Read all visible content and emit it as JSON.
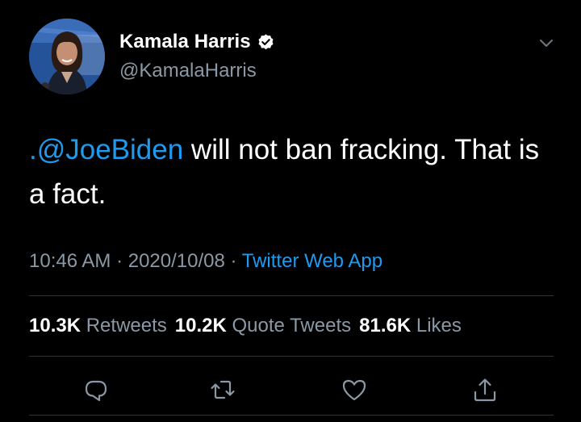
{
  "user": {
    "display_name": "Kamala Harris",
    "handle": "@KamalaHarris",
    "verified": true,
    "avatar_icon": "profile-photo"
  },
  "tweet": {
    "mention": ".@JoeBiden",
    "text_rest": " will not ban fracking. That is a fact."
  },
  "meta": {
    "time": "10:46 AM",
    "separator": " · ",
    "date": "2020/10/08",
    "source": "Twitter Web App"
  },
  "stats": {
    "retweets": {
      "count": "10.3K",
      "label": "Retweets"
    },
    "quote_tweets": {
      "count": "10.2K",
      "label": "Quote Tweets"
    },
    "likes": {
      "count": "81.6K",
      "label": "Likes"
    }
  },
  "actions": {
    "reply_icon": "reply-icon",
    "retweet_icon": "retweet-icon",
    "like_icon": "heart-icon",
    "share_icon": "share-icon"
  },
  "colors": {
    "background": "#000000",
    "text": "#ffffff",
    "secondary": "#8b98a5",
    "accent": "#1d9bf0",
    "divider": "#2f3336"
  }
}
